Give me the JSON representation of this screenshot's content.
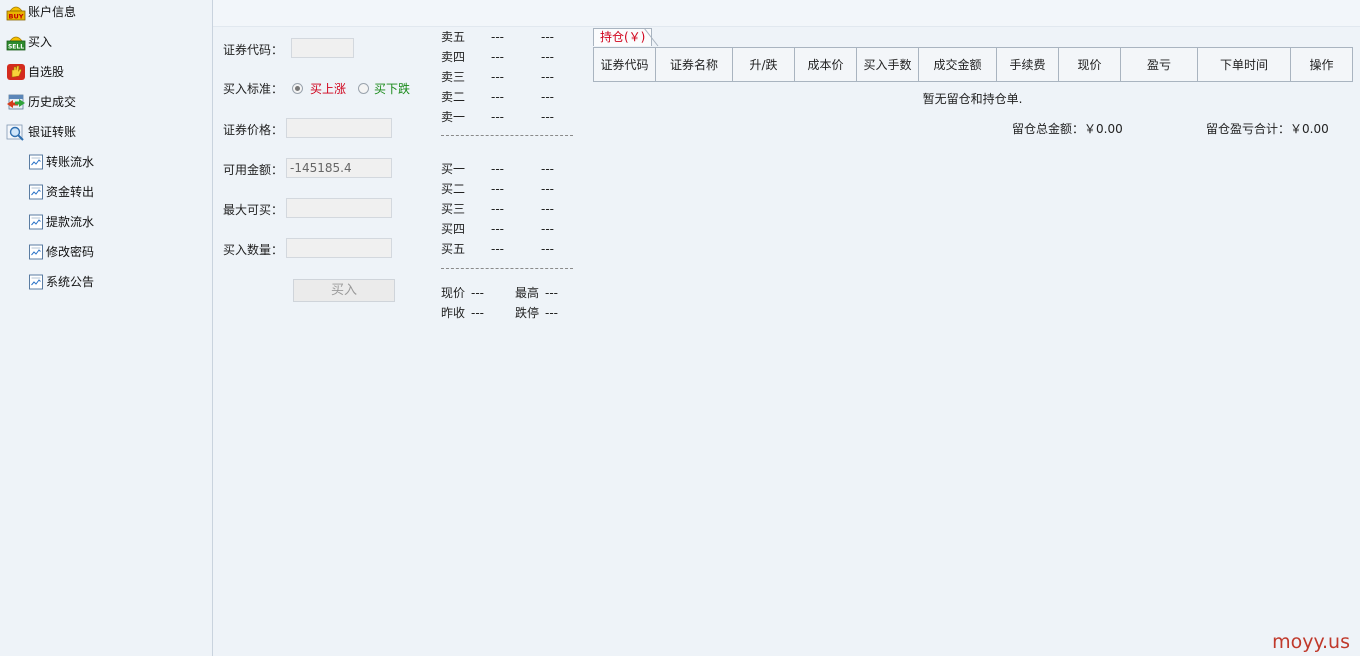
{
  "sidebar": {
    "items": [
      {
        "label": "账户信息",
        "icon": "buy-icon"
      },
      {
        "label": "买入",
        "icon": "sell-icon"
      },
      {
        "label": "自选股",
        "icon": "hand-icon"
      },
      {
        "label": "历史成交",
        "icon": "history-icon"
      },
      {
        "label": "银证转账",
        "icon": "magnifier-icon"
      }
    ],
    "subitems": [
      {
        "label": "转账流水",
        "icon": "document-icon"
      },
      {
        "label": "资金转出",
        "icon": "document-icon"
      },
      {
        "label": "提款流水",
        "icon": "document-icon"
      },
      {
        "label": "修改密码",
        "icon": "document-icon"
      },
      {
        "label": "系统公告",
        "icon": "document-icon"
      }
    ]
  },
  "form": {
    "code_label": "证券代码：",
    "code_value": "",
    "standard_label": "买入标准：",
    "radio_up": "买上涨",
    "radio_down": "买下跌",
    "price_label": "证券价格：",
    "price_value": "",
    "avail_label": "可用金额：",
    "avail_value": "-145185.4",
    "max_label": "最大可买：",
    "max_value": "",
    "qty_label": "买入数量：",
    "qty_value": "",
    "buy_button": "买入"
  },
  "quote": {
    "sell": [
      {
        "label": "卖五",
        "price": "---",
        "vol": "---"
      },
      {
        "label": "卖四",
        "price": "---",
        "vol": "---"
      },
      {
        "label": "卖三",
        "price": "---",
        "vol": "---"
      },
      {
        "label": "卖二",
        "price": "---",
        "vol": "---"
      },
      {
        "label": "卖一",
        "price": "---",
        "vol": "---"
      }
    ],
    "buy": [
      {
        "label": "买一",
        "price": "---",
        "vol": "---"
      },
      {
        "label": "买二",
        "price": "---",
        "vol": "---"
      },
      {
        "label": "买三",
        "price": "---",
        "vol": "---"
      },
      {
        "label": "买四",
        "price": "---",
        "vol": "---"
      },
      {
        "label": "买五",
        "price": "---",
        "vol": "---"
      }
    ],
    "current_label": "现价",
    "current_value": "---",
    "high_label": "最高",
    "high_value": "---",
    "prev_close_label": "昨收",
    "prev_close_value": "---",
    "limit_down_label": "跌停",
    "limit_down_value": "---"
  },
  "holdings": {
    "tab_label": "持仓(￥)",
    "columns": [
      "证券代码",
      "证券名称",
      "升/跌",
      "成本价",
      "买入手数",
      "成交金额",
      "手续费",
      "现价",
      "盈亏",
      "下单时间",
      "操作"
    ],
    "empty_message": "暂无留仓和持仓单.",
    "total_amount_label": "留仓总金额：￥0.00",
    "total_pl_label": "留仓盈亏合计：￥0.00"
  },
  "watermark": "moyy.us",
  "colors": {
    "background": "#eef3f8",
    "up_red": "#d0021b",
    "down_green": "#1a8a1a",
    "table_border": "#a9b4c0",
    "watermark": "#c0392b"
  }
}
